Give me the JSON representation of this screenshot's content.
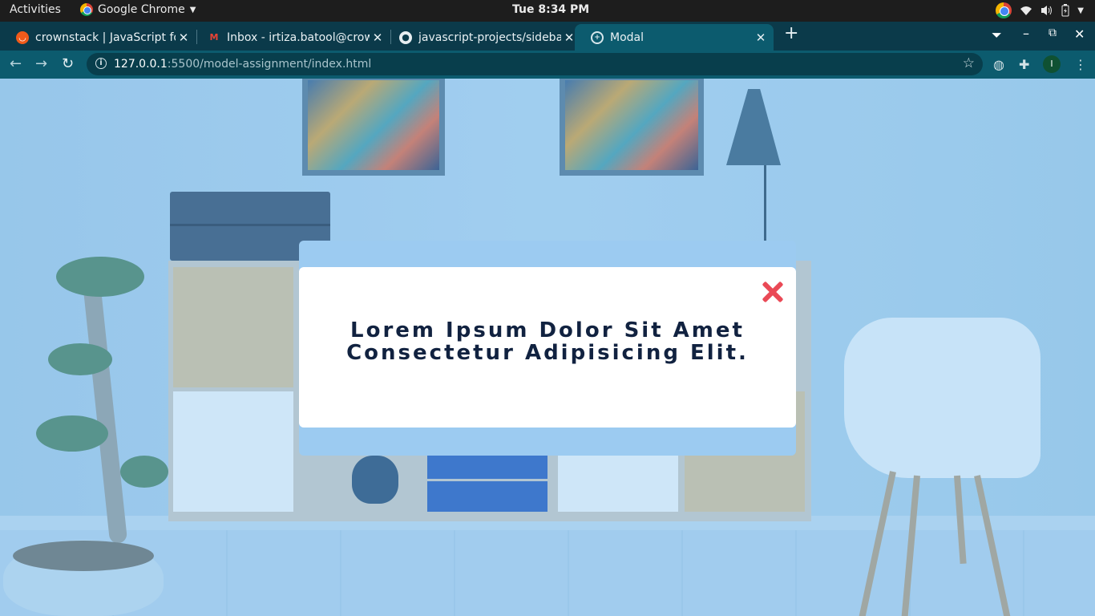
{
  "system_bar": {
    "activities": "Activities",
    "app_name": "Google Chrome",
    "clock": "Tue  8:34 PM",
    "tray_icons": [
      "chrome-icon",
      "wifi-icon",
      "volume-icon",
      "battery-icon",
      "power-menu-icon"
    ]
  },
  "tabs": [
    {
      "title": "crownstack | JavaScript fo",
      "favicon": "crownstack-icon",
      "active": false
    },
    {
      "title": "Inbox - irtiza.batool@crow",
      "favicon": "gmail-icon",
      "active": false
    },
    {
      "title": "javascript-projects/sideba",
      "favicon": "github-icon",
      "active": false
    },
    {
      "title": "Modal",
      "favicon": "globe-icon",
      "active": true
    }
  ],
  "toolbar": {
    "url_host": "127.0.0.1",
    "url_path": ":5500/model-assignment/index.html",
    "profile_initial": "I"
  },
  "modal": {
    "line1": "Lorem Ipsum Dolor Sit Amet",
    "line2": "Consectetur Adipisicing Elit.",
    "close_icon": "close-x-icon"
  },
  "colors": {
    "accent": "#0c5b6e",
    "close": "#ea4956",
    "modal_text": "#112240",
    "modal_band": "#9ccbf1"
  }
}
